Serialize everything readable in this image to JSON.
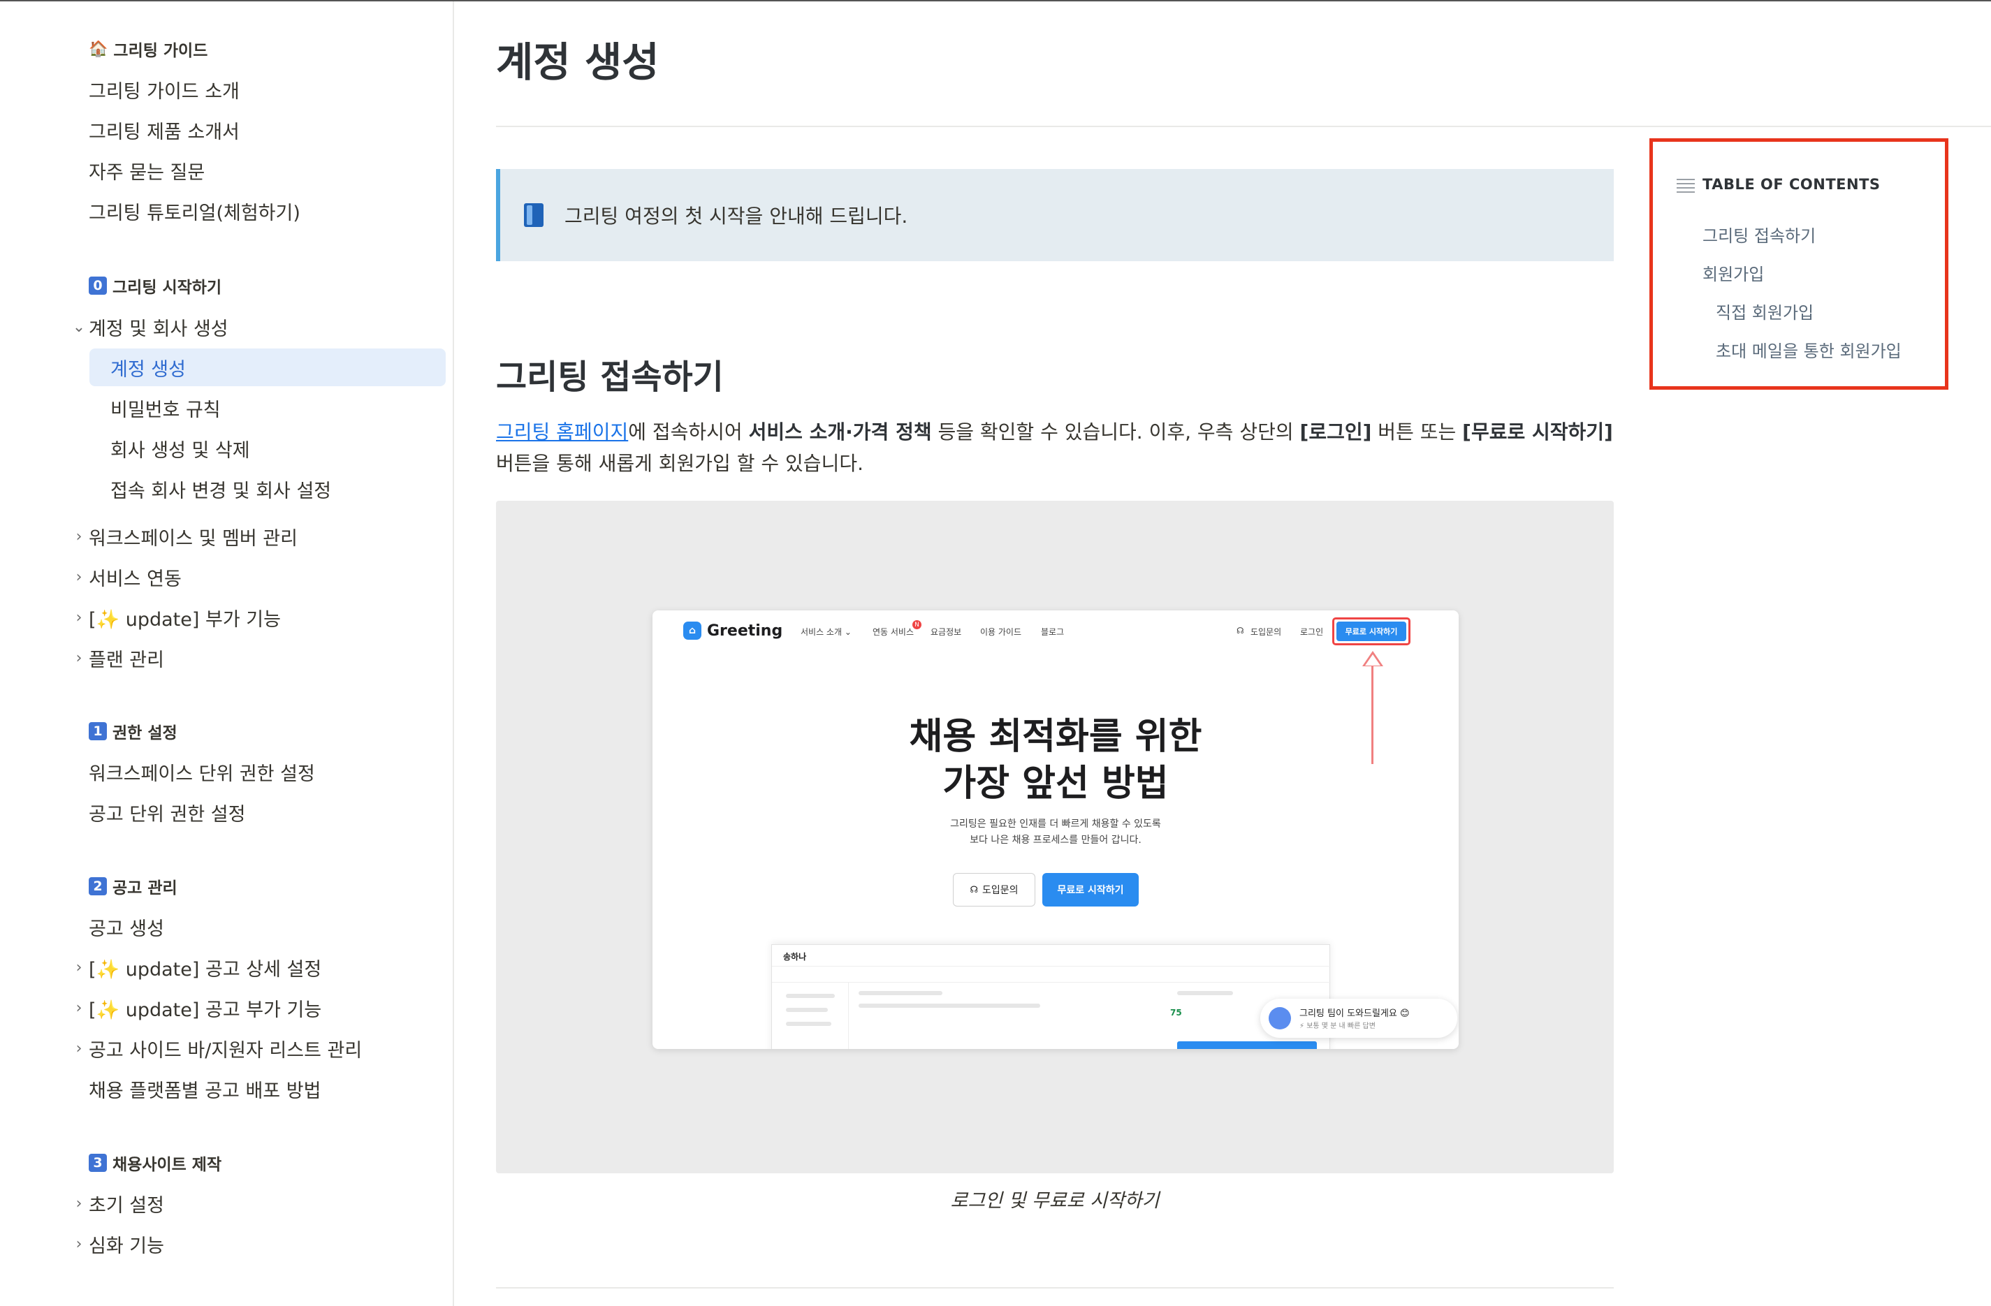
{
  "sidebar": {
    "guide_section": {
      "icon": "house-emoji",
      "label": "그리팅 가이드"
    },
    "guide_items": [
      "그리팅 가이드 소개",
      "그리팅 제품 소개서",
      "자주 묻는 질문",
      "그리팅 튜토리얼(체험하기)"
    ],
    "s0": {
      "badge": "0",
      "label": "그리팅 시작하기"
    },
    "s0_group": {
      "label": "계정 및 회사 생성",
      "state": "expanded"
    },
    "s0_group_items": [
      "계정 생성",
      "비밀번호 규칙",
      "회사 생성 및 삭제",
      "접속 회사 변경 및 회사 설정"
    ],
    "active_item": "계정 생성",
    "s0_collapsed": [
      "워크스페이스 및 멤버 관리",
      "서비스 연동",
      "[✨ update] 부가 기능",
      "플랜 관리"
    ],
    "s1": {
      "badge": "1",
      "label": "권한 설정"
    },
    "s1_items": [
      "워크스페이스 단위 권한 설정",
      "공고 단위 권한 설정"
    ],
    "s2": {
      "badge": "2",
      "label": "공고 관리"
    },
    "s2_items": [
      {
        "label": "공고 생성",
        "chevron": false
      },
      {
        "label": "[✨ update] 공고 상세 설정",
        "chevron": true
      },
      {
        "label": "[✨ update] 공고 부가 기능",
        "chevron": true
      },
      {
        "label": "공고 사이드 바/지원자 리스트 관리",
        "chevron": true
      },
      {
        "label": "채용 플랫폼별 공고 배포 방법",
        "chevron": false
      }
    ],
    "s3": {
      "badge": "3",
      "label": "채용사이트 제작"
    },
    "s3_items": [
      "초기 설정",
      "심화 기능"
    ]
  },
  "main": {
    "title": "계정 생성",
    "callout": {
      "icon": "blue-book-emoji",
      "text": "그리팅 여정의 첫 시작을 안내해 드립니다."
    },
    "h2": "그리팅 접속하기",
    "para": {
      "link": "그리팅 홈페이지",
      "t1": "에 접속하시어 ",
      "b1": "서비스 소개·가격 정책",
      "t2": " 등을 확인할 수 있습니다. 이후, 우측 상단의 ",
      "b2": "[로그인]",
      "t3": " 버튼 또는 ",
      "b3": "[무료로 시작하기]",
      "t4": " 버튼을 통해 새롭게 회원가입 할 수 있습니다."
    },
    "caption": "로그인 및 무료로 시작하기"
  },
  "screenshot": {
    "logo": "Greeting",
    "nav": [
      "서비스 소개 ⌄",
      "연동 서비스",
      "요금정보",
      "이용 가이드",
      "블로그"
    ],
    "nav_badge": "N",
    "right_nav": [
      "도입문의",
      "로그인"
    ],
    "cta": "무료로 시작하기",
    "hero_line1": "채용 최적화를 위한",
    "hero_line2": "가장 앞선 방법",
    "sub_line1": "그리팅은 필요한 인재를 더 빠르게 채용할 수 있도록",
    "sub_line2": "보다 나은 채용 프로세스를 만들어 갑니다.",
    "btn_inquiry": "도입문의",
    "btn_start": "무료로 시작하기",
    "app_name": "송하나",
    "app_score": "75",
    "chat_title": "그리팅 팀이 도와드릴게요 😊",
    "chat_sub": "⚡ 보통 몇 분 내 빠른 답변"
  },
  "toc": {
    "heading": "TABLE OF CONTENTS",
    "items": [
      "그리팅 접속하기",
      "회원가입",
      "직접 회원가입",
      "초대 메일을 통한 회원가입"
    ],
    "highlight_color": "#e8341c"
  },
  "colors": {
    "accent": "#2f6bd0",
    "active_bg": "#e4eefb",
    "callout_bg": "#e4ecf1",
    "link": "#1a73e8"
  }
}
